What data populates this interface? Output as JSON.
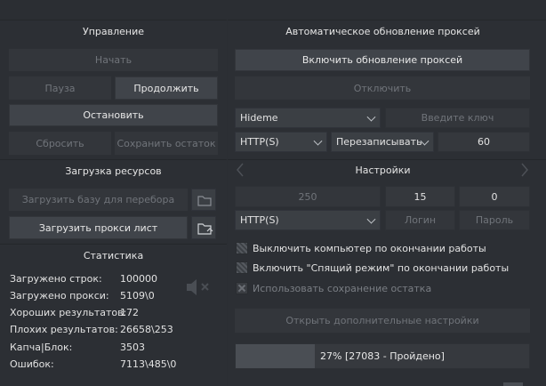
{
  "left": {
    "control": {
      "title": "Управление",
      "start": "Начать",
      "pause": "Пауза",
      "resume": "Продолжить",
      "stop": "Остановить",
      "reset": "Сбросить",
      "save_rest": "Сохранить остаток"
    },
    "resources": {
      "title": "Загрузка ресурсов",
      "load_base": "Загрузить базу для перебора",
      "load_proxy": "Загрузить прокси лист"
    },
    "stats": {
      "title": "Статистика",
      "rows": [
        {
          "label": "Загружено строк:",
          "value": "100000"
        },
        {
          "label": "Загружено прокси:",
          "value": "5109\\0"
        },
        {
          "label": "Хороших результатов:",
          "value": "172"
        },
        {
          "label": "Плохих результатов:",
          "value": "26658\\253"
        },
        {
          "label": "Капча|Блок:",
          "value": "3503"
        },
        {
          "label": "Ошибок:",
          "value": "7113\\485\\0"
        }
      ]
    }
  },
  "right": {
    "proxy_update": {
      "title": "Автоматическое обновление проксей",
      "enable": "Включить обновление проксей",
      "disable": "Отключить",
      "source": "Hideme",
      "key_placeholder": "Введите ключ",
      "proxy_type": "HTTP(S)",
      "mode": "Перезаписывать",
      "interval": "60"
    },
    "settings": {
      "title": "Настройки",
      "threads": "250",
      "field2": "15",
      "field3": "0",
      "proxy_type": "HTTP(S)",
      "login": "Логин",
      "password": "Пароль",
      "opt_shutdown": "Выключить компьютер по окончании работы",
      "opt_sleep": "Включить \"Спящий режим\" по окончании работы",
      "opt_save_rest": "Использовать сохранение остатка",
      "more": "Открыть дополнительные настройки"
    },
    "progress": {
      "text": "27% [27083 - Пройдено]",
      "value": 0.27
    }
  }
}
